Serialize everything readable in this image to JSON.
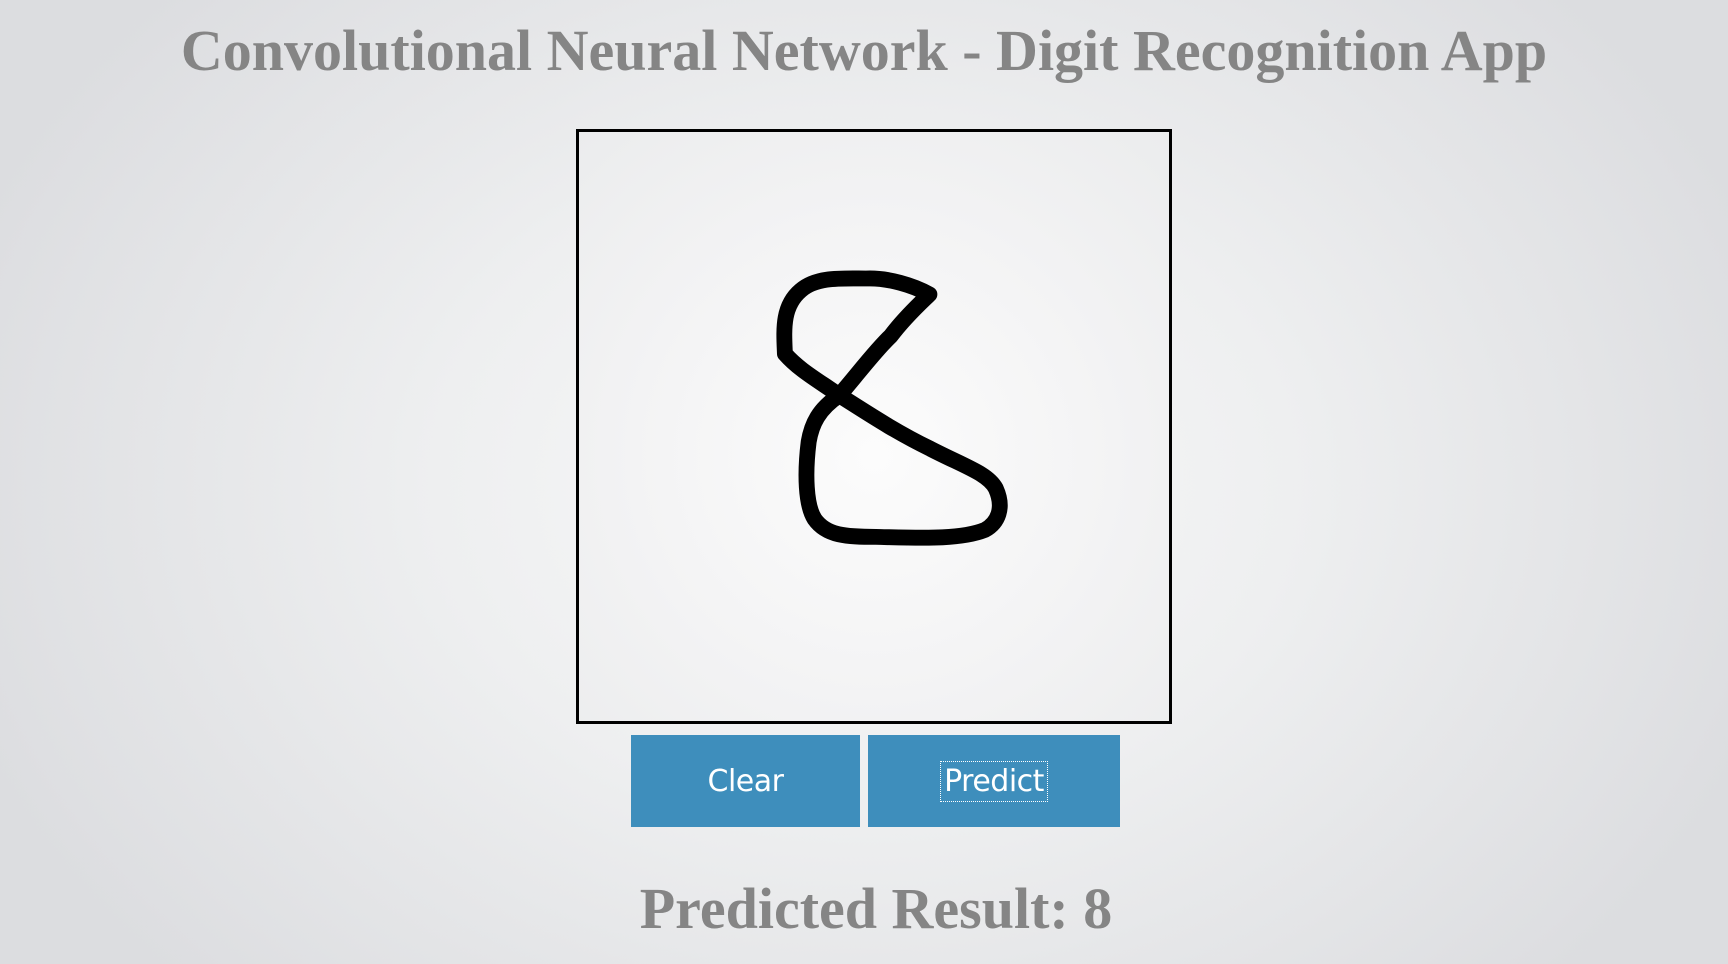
{
  "app": {
    "title": "Convolutional Neural Network - Digit Recognition App"
  },
  "canvas": {
    "stroke_color": "#000000",
    "border_color": "#000000"
  },
  "buttons": {
    "clear_label": "Clear",
    "predict_label": "Predict",
    "color": "#3e8ebc",
    "text_color": "#ffffff"
  },
  "result": {
    "text": "Predicted Result: 8",
    "color": "#858585"
  }
}
